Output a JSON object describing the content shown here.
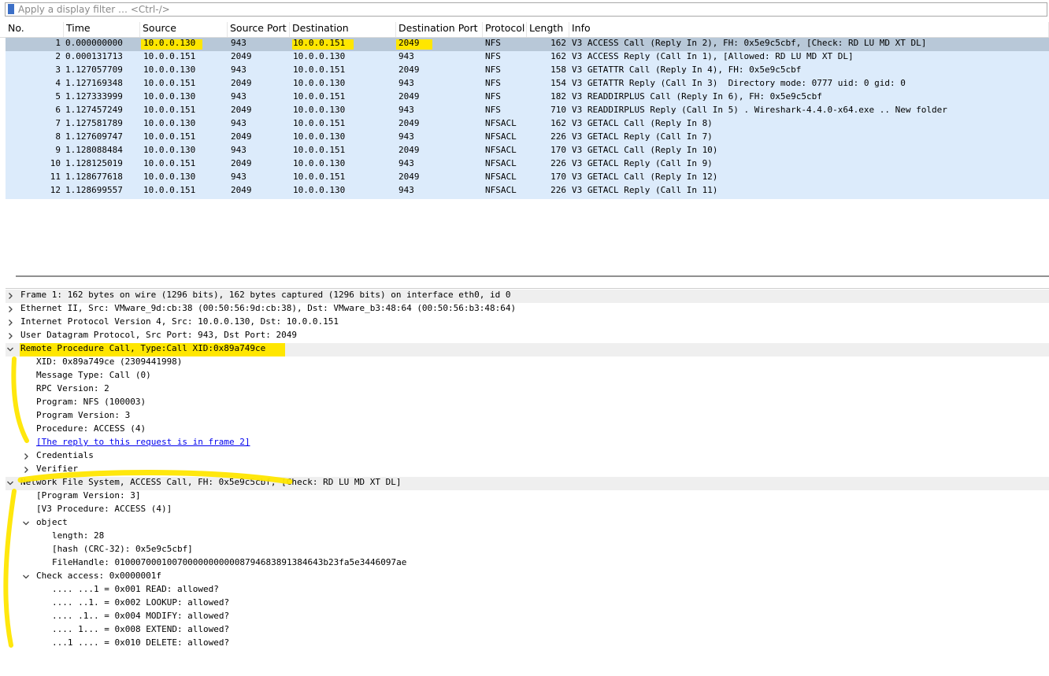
{
  "filter": {
    "placeholder": "Apply a display filter … <Ctrl-/>"
  },
  "columns": [
    "No.",
    "Time",
    "Source",
    "Source Port",
    "Destination",
    "Destination Port",
    "Protocol",
    "Length",
    "Info"
  ],
  "packets": [
    {
      "no": "1",
      "time": "0.000000000",
      "src": "10.0.0.130",
      "sport": "943",
      "dst": "10.0.0.151",
      "dport": "2049",
      "proto": "NFS",
      "len": "162",
      "info": "V3 ACCESS Call (Reply In 2), FH: 0x5e9c5cbf, [Check: RD LU MD XT DL]"
    },
    {
      "no": "2",
      "time": "0.000131713",
      "src": "10.0.0.151",
      "sport": "2049",
      "dst": "10.0.0.130",
      "dport": "943",
      "proto": "NFS",
      "len": "162",
      "info": "V3 ACCESS Reply (Call In 1), [Allowed: RD LU MD XT DL]"
    },
    {
      "no": "3",
      "time": "1.127057709",
      "src": "10.0.0.130",
      "sport": "943",
      "dst": "10.0.0.151",
      "dport": "2049",
      "proto": "NFS",
      "len": "158",
      "info": "V3 GETATTR Call (Reply In 4), FH: 0x5e9c5cbf"
    },
    {
      "no": "4",
      "time": "1.127169348",
      "src": "10.0.0.151",
      "sport": "2049",
      "dst": "10.0.0.130",
      "dport": "943",
      "proto": "NFS",
      "len": "154",
      "info": "V3 GETATTR Reply (Call In 3)  Directory mode: 0777 uid: 0 gid: 0"
    },
    {
      "no": "5",
      "time": "1.127333999",
      "src": "10.0.0.130",
      "sport": "943",
      "dst": "10.0.0.151",
      "dport": "2049",
      "proto": "NFS",
      "len": "182",
      "info": "V3 READDIRPLUS Call (Reply In 6), FH: 0x5e9c5cbf"
    },
    {
      "no": "6",
      "time": "1.127457249",
      "src": "10.0.0.151",
      "sport": "2049",
      "dst": "10.0.0.130",
      "dport": "943",
      "proto": "NFS",
      "len": "710",
      "info": "V3 READDIRPLUS Reply (Call In 5) . Wireshark-4.4.0-x64.exe .. New folder"
    },
    {
      "no": "7",
      "time": "1.127581789",
      "src": "10.0.0.130",
      "sport": "943",
      "dst": "10.0.0.151",
      "dport": "2049",
      "proto": "NFSACL",
      "len": "162",
      "info": "V3 GETACL Call (Reply In 8)"
    },
    {
      "no": "8",
      "time": "1.127609747",
      "src": "10.0.0.151",
      "sport": "2049",
      "dst": "10.0.0.130",
      "dport": "943",
      "proto": "NFSACL",
      "len": "226",
      "info": "V3 GETACL Reply (Call In 7)"
    },
    {
      "no": "9",
      "time": "1.128088484",
      "src": "10.0.0.130",
      "sport": "943",
      "dst": "10.0.0.151",
      "dport": "2049",
      "proto": "NFSACL",
      "len": "170",
      "info": "V3 GETACL Call (Reply In 10)"
    },
    {
      "no": "10",
      "time": "1.128125019",
      "src": "10.0.0.151",
      "sport": "2049",
      "dst": "10.0.0.130",
      "dport": "943",
      "proto": "NFSACL",
      "len": "226",
      "info": "V3 GETACL Reply (Call In 9)"
    },
    {
      "no": "11",
      "time": "1.128677618",
      "src": "10.0.0.130",
      "sport": "943",
      "dst": "10.0.0.151",
      "dport": "2049",
      "proto": "NFSACL",
      "len": "170",
      "info": "V3 GETACL Call (Reply In 12)"
    },
    {
      "no": "12",
      "time": "1.128699557",
      "src": "10.0.0.151",
      "sport": "2049",
      "dst": "10.0.0.130",
      "dport": "943",
      "proto": "NFSACL",
      "len": "226",
      "info": "V3 GETACL Reply (Call In 11)"
    }
  ],
  "details": [
    {
      "chev": "right",
      "text": "Frame 1: 162 bytes on wire (1296 bits), 162 bytes captured (1296 bits) on interface eth0, id 0"
    },
    {
      "chev": "right",
      "text": "Ethernet II, Src: VMware_9d:cb:38 (00:50:56:9d:cb:38), Dst: VMware_b3:48:64 (00:50:56:b3:48:64)"
    },
    {
      "chev": "right",
      "text": "Internet Protocol Version 4, Src: 10.0.0.130, Dst: 10.0.0.151"
    },
    {
      "chev": "right",
      "text": "User Datagram Protocol, Src Port: 943, Dst Port: 2049"
    },
    {
      "chev": "down",
      "text": "Remote Procedure Call, Type:Call XID:0x89a749ce"
    },
    {
      "chev": "none",
      "text": "XID: 0x89a749ce (2309441998)"
    },
    {
      "chev": "none",
      "text": "Message Type: Call (0)"
    },
    {
      "chev": "none",
      "text": "RPC Version: 2"
    },
    {
      "chev": "none",
      "text": "Program: NFS (100003)"
    },
    {
      "chev": "none",
      "text": "Program Version: 3"
    },
    {
      "chev": "none",
      "text": "Procedure: ACCESS (4)"
    },
    {
      "chev": "none",
      "text": "[The reply to this request is in frame 2]"
    },
    {
      "chev": "right",
      "text": "Credentials"
    },
    {
      "chev": "right",
      "text": "Verifier"
    },
    {
      "chev": "down",
      "text": "Network File System, ACCESS Call, FH: 0x5e9c5cbf, [Check: RD LU MD XT DL]"
    },
    {
      "chev": "none",
      "text": "[Program Version: 3]"
    },
    {
      "chev": "none",
      "text": "[V3 Procedure: ACCESS (4)]"
    },
    {
      "chev": "down",
      "text": "object"
    },
    {
      "chev": "none",
      "text": "length: 28"
    },
    {
      "chev": "none",
      "text": "[hash (CRC-32): 0x5e9c5cbf]"
    },
    {
      "chev": "none",
      "text": "FileHandle: 0100070001007000000000008794683891384643b23fa5e3446097ae"
    },
    {
      "chev": "down",
      "text": "Check access: 0x0000001f"
    },
    {
      "chev": "none",
      "text": ".... ...1 = 0x001 READ: allowed?"
    },
    {
      "chev": "none",
      "text": ".... ..1. = 0x002 LOOKUP: allowed?"
    },
    {
      "chev": "none",
      "text": ".... .1.. = 0x004 MODIFY: allowed?"
    },
    {
      "chev": "none",
      "text": ".... 1... = 0x008 EXTEND: allowed?"
    },
    {
      "chev": "none",
      "text": "...1 .... = 0x010 DELETE: allowed?"
    }
  ],
  "colors": {
    "list_bg": "#dcebfb",
    "selected_row": "#b8c8d8",
    "highlight": "#ffe600",
    "link": "#0000ee"
  },
  "icons": {
    "filter": "bookmark-icon",
    "expand": "chevron-right-icon",
    "collapse": "chevron-down-icon"
  }
}
